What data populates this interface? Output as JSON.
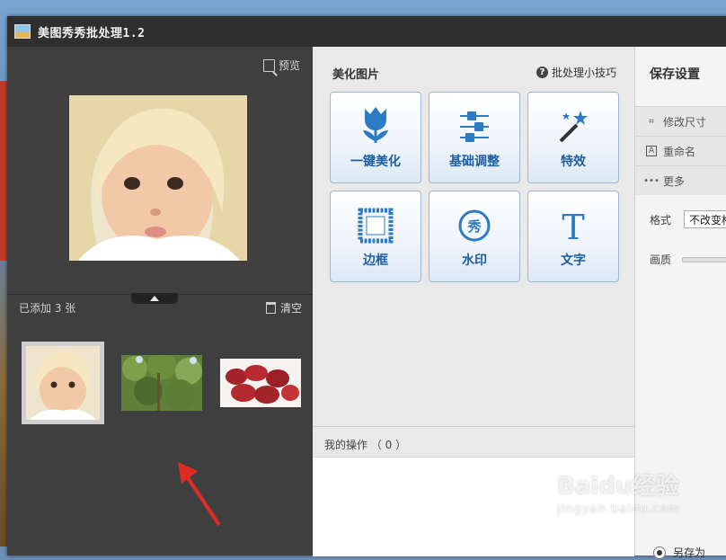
{
  "window": {
    "title": "美图秀秀批处理1.2"
  },
  "left_panel": {
    "preview_label": "预览",
    "added_count_label": "已添加 3 张",
    "clear_label": "清空"
  },
  "middle_panel": {
    "heading": "美化图片",
    "tips_label": "批处理小技巧",
    "tools": [
      {
        "label": "一键美化",
        "icon": "tulip-icon"
      },
      {
        "label": "基础调整",
        "icon": "sliders-icon"
      },
      {
        "label": "特效",
        "icon": "magic-wand-icon"
      },
      {
        "label": "边框",
        "icon": "frame-icon"
      },
      {
        "label": "水印",
        "icon": "watermark-seal-icon"
      },
      {
        "label": "文字",
        "icon": "text-T-icon"
      }
    ],
    "ops_label": "我的操作 （ 0 ）"
  },
  "right_panel": {
    "title": "保存设置",
    "items": [
      {
        "label": "修改尺寸",
        "icon": "crop-icon"
      },
      {
        "label": "重命名",
        "icon": "rename-icon"
      },
      {
        "label": "更多",
        "icon": "more-dots-icon"
      }
    ],
    "format_label": "格式",
    "format_value": "不改变格式",
    "quality_label": "画质",
    "save_as_label": "另存为"
  },
  "watermark": {
    "brand": "Baidu经验",
    "url": "jingyan.baidu.com"
  },
  "colors": {
    "accent": "#1c5ea0",
    "dark_panel": "#3f3f3f"
  }
}
